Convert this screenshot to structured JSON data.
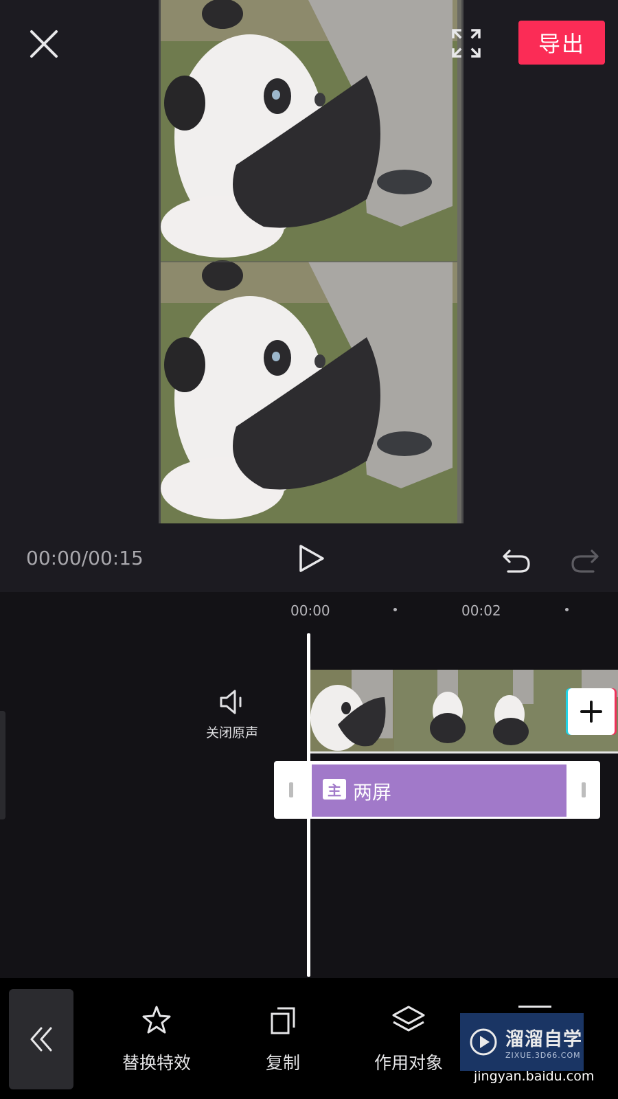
{
  "header": {
    "export_label": "导出",
    "close_icon": "close-icon",
    "fullscreen_icon": "fullscreen-icon"
  },
  "player": {
    "timecode": "00:00/00:15",
    "play_icon": "play-icon",
    "undo_icon": "undo-icon",
    "redo_icon": "redo-icon"
  },
  "timeline": {
    "ruler": [
      "00:00",
      "00:02"
    ],
    "mute_label": "关闭原声",
    "effect": {
      "badge": "主",
      "name": "两屏",
      "color": "#a179c9"
    }
  },
  "toolbar": {
    "items": [
      {
        "label": "替换特效",
        "icon": "sparkle-icon"
      },
      {
        "label": "复制",
        "icon": "copy-icon"
      },
      {
        "label": "作用对象",
        "icon": "layers-icon"
      }
    ]
  },
  "watermark": {
    "title": "溜溜自学",
    "subtitle": "ZIXUE.3D66.COM",
    "url": "jingyan.baidu.com"
  },
  "colors": {
    "accent": "#fb2c56",
    "background": "#1b1a1f",
    "timeline": "#131216",
    "effect": "#a179c9"
  }
}
